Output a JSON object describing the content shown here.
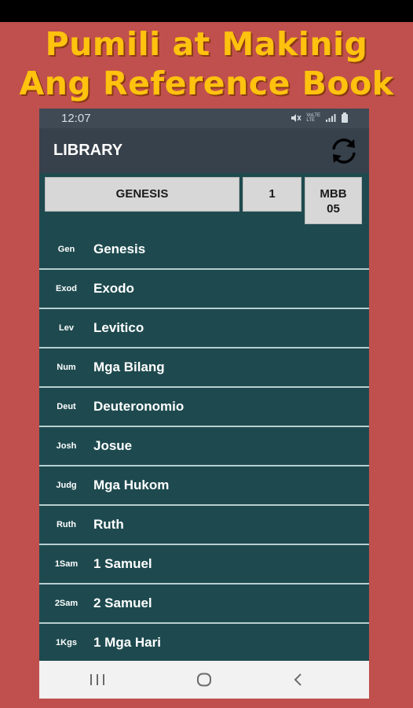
{
  "promo": {
    "line1": "Pumili at Makinig",
    "line2": "Ang Reference Book"
  },
  "status": {
    "time": "12:07",
    "icons": [
      "mute-icon",
      "volte-lte-icon",
      "signal-icon",
      "battery-icon"
    ],
    "volte_text": "VoLTE",
    "lte_text": "LTE"
  },
  "appbar": {
    "title": "LIBRARY",
    "refresh_icon": "refresh-icon"
  },
  "controls": {
    "book": "GENESIS",
    "chapter": "1",
    "version_line1": "MBB",
    "version_line2": "05"
  },
  "books": [
    {
      "abbr": "Gen",
      "name": "Genesis"
    },
    {
      "abbr": "Exod",
      "name": "Exodo"
    },
    {
      "abbr": "Lev",
      "name": "Levitico"
    },
    {
      "abbr": "Num",
      "name": "Mga Bilang"
    },
    {
      "abbr": "Deut",
      "name": "Deuteronomio"
    },
    {
      "abbr": "Josh",
      "name": "Josue"
    },
    {
      "abbr": "Judg",
      "name": "Mga Hukom"
    },
    {
      "abbr": "Ruth",
      "name": "Ruth"
    },
    {
      "abbr": "1Sam",
      "name": "1 Samuel"
    },
    {
      "abbr": "2Sam",
      "name": "2 Samuel"
    },
    {
      "abbr": "1Kgs",
      "name": "1 Mga Hari"
    }
  ],
  "navbar": {
    "recents": "recents-icon",
    "home": "home-icon",
    "back": "back-icon"
  },
  "colors": {
    "page_bg": "#c0504d",
    "promo_text": "#ffc20e",
    "list_bg": "#1e4a4f",
    "appbar": "#37414b",
    "button_bg": "#d7d7d7"
  }
}
